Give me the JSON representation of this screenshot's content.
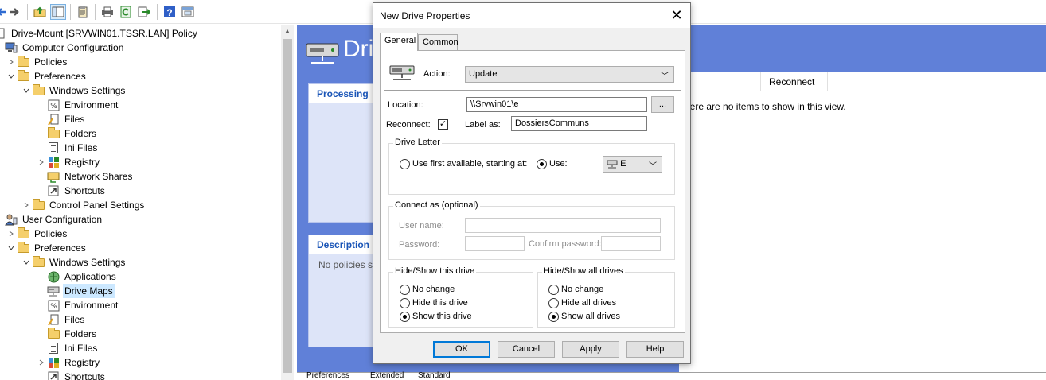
{
  "toolbar": {
    "buttons": [
      "back-icon",
      "forward-icon",
      "up-folder-icon",
      "show-hide-tree-icon",
      "properties-icon",
      "print-icon",
      "refresh-icon",
      "export-icon",
      "help-icon",
      "view-icon"
    ]
  },
  "tree": {
    "root": "Drive-Mount [SRVWIN01.TSSR.LAN] Policy",
    "computer": "Computer Configuration",
    "policies": "Policies",
    "preferences": "Preferences",
    "windows_settings": "Windows Settings",
    "environment": "Environment",
    "files": "Files",
    "folders": "Folders",
    "ini_files": "Ini Files",
    "registry": "Registry",
    "network_shares": "Network Shares",
    "shortcuts": "Shortcuts",
    "control_panel": "Control Panel Settings",
    "user": "User Configuration",
    "applications": "Applications",
    "drive_maps": "Drive Maps"
  },
  "pane": {
    "title": "Dri",
    "processing": "Processing",
    "description": "Description",
    "description_text": "No policies s",
    "col_reconnect": "Reconnect",
    "empty_text": "here are no items to show in this view.",
    "bottom_tabs": [
      "Preferences",
      "Extended",
      "Standard"
    ]
  },
  "dialog": {
    "title": "New Drive Properties",
    "tab_general": "General",
    "tab_common": "Common",
    "action_label": "Action:",
    "action_value": "Update",
    "location_label": "Location:",
    "location_value": "\\\\Srvwin01\\e",
    "browse_label": "...",
    "reconnect_label": "Reconnect:",
    "reconnect_check": "✓",
    "label_as_label": "Label as:",
    "label_as_value": "DossiersCommuns",
    "drive_letter_group": "Drive Letter",
    "use_first_available": "Use first available, starting at:",
    "use_label": "Use:",
    "use_value": "E",
    "connect_as_group": "Connect as (optional)",
    "username_label": "User name:",
    "password_label": "Password:",
    "confirm_password_label": "Confirm password:",
    "hide_show_drive_group": "Hide/Show this drive",
    "no_change": "No change",
    "hide_this_drive": "Hide this drive",
    "show_this_drive": "Show this drive",
    "hide_show_all_group": "Hide/Show all drives",
    "hide_all_drives": "Hide all drives",
    "show_all_drives": "Show all drives",
    "ok": "OK",
    "cancel": "Cancel",
    "apply": "Apply",
    "help": "Help"
  },
  "colors": {
    "pane_background": "#6080d8",
    "selection": "#cce8ff",
    "panel_header_text": "#1a55b7"
  }
}
